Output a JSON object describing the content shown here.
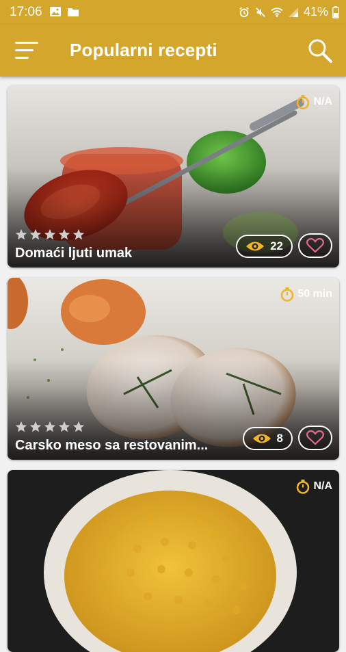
{
  "status_bar": {
    "time": "17:06",
    "battery": "41%",
    "left_icons": [
      "image-icon",
      "folder-icon"
    ],
    "right_icons": [
      "alarm-icon",
      "mute-icon",
      "wifi-icon",
      "signal-icon",
      "battery-icon"
    ]
  },
  "app_bar": {
    "title": "Popularni recepti",
    "menu_icon": "hamburger-menu-icon",
    "search_icon": "search-icon"
  },
  "colors": {
    "brand": "#d4a72c",
    "background": "#f1f1f1",
    "accent_icon": "#f0b429",
    "heart": "#e66a8a"
  },
  "recipes": [
    {
      "title": "Domaći ljuti umak",
      "time": "N/A",
      "views": "22",
      "rating": 0,
      "max_rating": 5
    },
    {
      "title": "Carsko meso sa restovanim...",
      "time": "50 min",
      "views": "8",
      "rating": 0,
      "max_rating": 5
    },
    {
      "title": "",
      "time": "N/A",
      "views": "",
      "rating": 0,
      "max_rating": 5
    }
  ]
}
